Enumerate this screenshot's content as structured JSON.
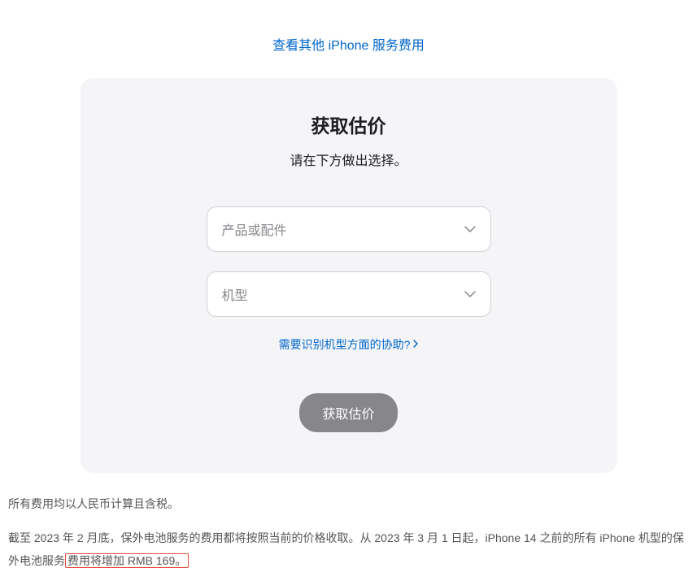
{
  "topLink": "查看其他 iPhone 服务费用",
  "card": {
    "title": "获取估价",
    "subtitle": "请在下方做出选择。",
    "select1Placeholder": "产品或配件",
    "select2Placeholder": "机型",
    "helpLink": "需要识别机型方面的协助?",
    "submitLabel": "获取估价"
  },
  "footnote": {
    "line1": "所有费用均以人民币计算且含税。",
    "line2_part1": "截至 2023 年 2 月底，保外电池服务的费用都将按照当前的价格收取。从 2023 年 3 月 1 日起，iPhone 14 之前的所有 iPhone 机型的保外电池服务",
    "line2_highlight": "费用将增加 RMB 169。"
  }
}
